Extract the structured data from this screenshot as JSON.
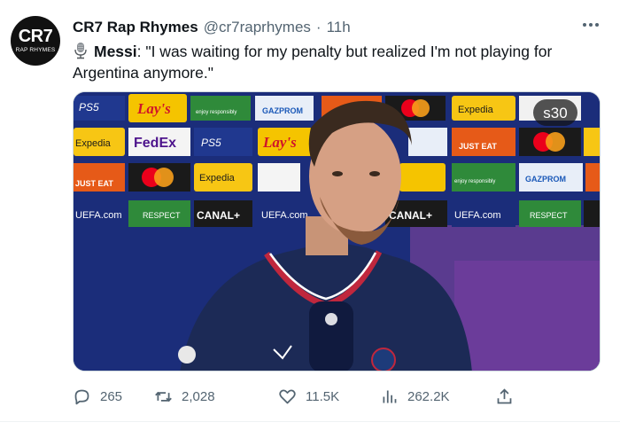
{
  "account": {
    "avatar_logo": "CR7",
    "avatar_sub": "RAP RHYMES",
    "display_name": "CR7 Rap Rhymes",
    "handle": "@cr7raprhymes",
    "separator": "·",
    "time": "11h"
  },
  "tweet": {
    "icon": "microphone-icon",
    "speaker": "Messi",
    "text_suffix": ": \"I was waiting for my penalty but realized I'm not playing for Argentina anymore.\""
  },
  "media": {
    "video_badge": "s30",
    "board_texts": {
      "ps5": "PS5",
      "lays": "Lay's",
      "responsibly": "enjoy responsibly",
      "gazprom": "GAZPROM",
      "expedia": "Expedia",
      "fedex": "FedEx",
      "just_eat": "JUST EAT",
      "uefa": "UEFA.com",
      "respect": "RESPECT",
      "canal": "CANAL+"
    }
  },
  "actions": {
    "replies": "265",
    "retweets": "2,028",
    "likes": "11.5K",
    "views": "262.2K"
  },
  "colors": {
    "text_primary": "#0f1419",
    "text_secondary": "#536471",
    "board_blue": "#1b2d7a",
    "psg_navy": "#1c2a56"
  }
}
